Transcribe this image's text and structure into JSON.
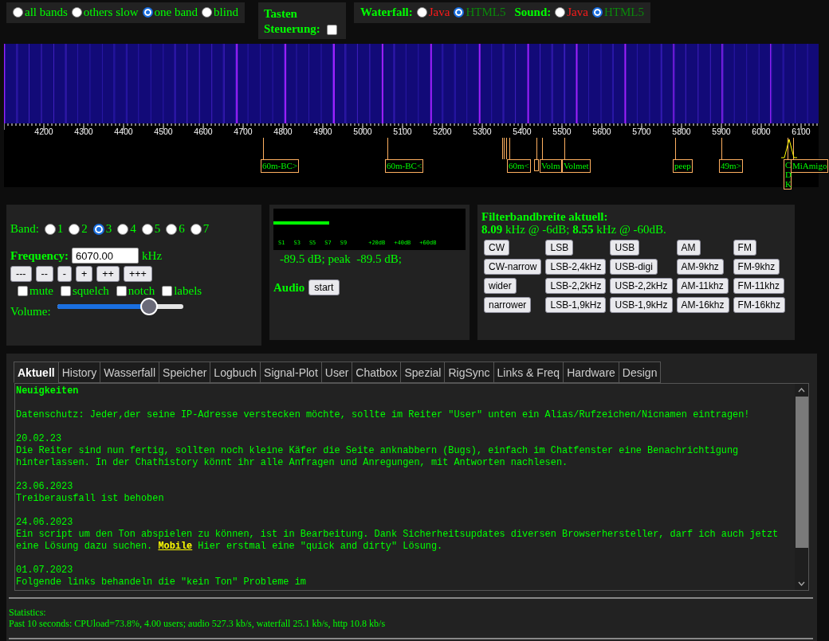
{
  "view_modes": [
    {
      "label": "all bands",
      "selected": false
    },
    {
      "label": "others slow",
      "selected": false
    },
    {
      "label": "one band",
      "selected": true
    },
    {
      "label": "blind",
      "selected": false
    }
  ],
  "key_control": {
    "label": "Tasten Steuerung:",
    "checked": false
  },
  "clients": [
    {
      "label": "Waterfall:",
      "options": [
        {
          "label": "Java",
          "selected": false
        },
        {
          "label": "HTML5",
          "selected": true
        }
      ]
    },
    {
      "label": "Sound:",
      "options": [
        {
          "label": "Java",
          "selected": false
        },
        {
          "label": "HTML5",
          "selected": true
        }
      ]
    }
  ],
  "scale": {
    "labels": [
      "4200",
      "4300",
      "4400",
      "4500",
      "4600",
      "4700",
      "4800",
      "4900",
      "5000",
      "5100",
      "5200",
      "5300",
      "5400",
      "5500",
      "5600",
      "5700",
      "5800",
      "5900",
      "6000",
      "6100"
    ]
  },
  "stations": [
    {
      "kind": "label",
      "label": "60m-BC>"
    },
    {
      "kind": "label",
      "label": "60m-BC<"
    },
    {
      "kind": "line"
    },
    {
      "kind": "line"
    },
    {
      "kind": "line"
    },
    {
      "kind": "label",
      "label": "60m<"
    },
    {
      "kind": "stub"
    },
    {
      "kind": "label",
      "label": "Volm"
    },
    {
      "kind": "label",
      "label": "Volmet"
    },
    {
      "kind": "label",
      "label": "peep"
    },
    {
      "kind": "label",
      "label": "49m>"
    },
    {
      "kind": "vertical",
      "label": "CDK"
    },
    {
      "kind": "label",
      "label": "MiAmigo"
    }
  ],
  "band": {
    "label": "Band:",
    "options": [
      {
        "label": "1",
        "selected": false
      },
      {
        "label": "2",
        "selected": false
      },
      {
        "label": "3",
        "selected": true
      },
      {
        "label": "4",
        "selected": false
      },
      {
        "label": "5",
        "selected": false
      },
      {
        "label": "6",
        "selected": false
      },
      {
        "label": "7",
        "selected": false
      }
    ]
  },
  "frequency": {
    "label": "Frequency:",
    "value": "6070.00",
    "unit": "kHz"
  },
  "step_buttons": [
    "---",
    "--",
    "-",
    "+",
    "++",
    "+++"
  ],
  "toggles": [
    {
      "label": "mute",
      "checked": false
    },
    {
      "label": "squelch",
      "checked": false
    },
    {
      "label": "notch",
      "checked": false
    },
    {
      "label": "labels",
      "checked": false
    }
  ],
  "volume": {
    "label": "Volume:",
    "level": 0.73
  },
  "smeter": {
    "level": 0.29,
    "scale": [
      "S1",
      "S3",
      "S5",
      "S7",
      "S9",
      "+20dB",
      "+40dB",
      "+60dB"
    ],
    "reading": "-89.5 dB; peak  -89.5 dB;"
  },
  "audio": {
    "label": "Audio",
    "button": "start"
  },
  "filter": {
    "title": "Filterbandbreite aktuell:",
    "bandwidth": "**8.09** kHz @ -6dB; **8.55** kHz @ -60dB.",
    "rows": [
      [
        "CW",
        "LSB",
        "USB",
        "AM",
        "FM"
      ],
      [
        "CW-narrow",
        "LSB-2,4kHz",
        "USB-digi",
        "AM-9khz",
        "FM-9khz"
      ],
      [
        "wider",
        "LSB-2,2kHz",
        "USB-2,2kHz",
        "AM-11khz",
        "FM-11khz"
      ],
      [
        "narrower",
        "LSB-1,9kHz",
        "USB-1,9kHz",
        "AM-16khz",
        "FM-16khz"
      ]
    ]
  },
  "tabs": [
    {
      "label": "Aktuell",
      "selected": true
    },
    {
      "label": "History",
      "selected": false
    },
    {
      "label": "Wasserfall",
      "selected": false
    },
    {
      "label": "Speicher",
      "selected": false
    },
    {
      "label": "Logbuch",
      "selected": false
    },
    {
      "label": "Signal-Plot",
      "selected": false
    },
    {
      "label": "User",
      "selected": false
    },
    {
      "label": "Chatbox",
      "selected": false
    },
    {
      "label": "Spezial",
      "selected": false
    },
    {
      "label": "RigSync",
      "selected": false
    },
    {
      "label": "Links & Freq",
      "selected": false
    },
    {
      "label": "Hardware",
      "selected": false
    },
    {
      "label": "Design",
      "selected": false
    }
  ],
  "news": {
    "title": "Neuigkeiten",
    "entries": [
      {
        "text": "Datenschutz: Jeder,der seine IP-Adresse verstecken möchte, sollte im Reiter \"User\" unten ein Alias/Rufzeichen/Nicnamen eintragen!"
      },
      {
        "date": "20.02.23",
        "text": "Die Reiter sind nun fertig, sollten noch kleine Käfer die Seite anknabbern (Bugs), einfach im Chatfenster eine Benachrichtigung hinterlassen. In der Chathistory könnt ihr alle Anfragen und Anregungen, mit Antworten nachlesen."
      },
      {
        "date": "23.06.2023",
        "text": "Treiberausfall ist behoben"
      },
      {
        "date": "24.06.2023",
        "text": "Ein script um den Ton abspielen zu können, ist in Bearbeitung. Dank Sicherheitsupdates diversen Browserhersteller, darf ich auch jetzt eine Lösung dazu suchen.",
        "link": "Mobile",
        "text_after": "Hier erstmal eine \"quick and dirty\" Lösung."
      },
      {
        "date": "01.07.2023",
        "text": "Folgende links behandeln die \"kein Ton\" Probleme im"
      }
    ]
  },
  "statistics": {
    "title": "Statistics:",
    "text": "Past 10 seconds: CPUload=73.8%, 4.00 users; audio 527.3 kb/s, waterfall 25.1 kb/s, http 10.8 kb/s"
  }
}
